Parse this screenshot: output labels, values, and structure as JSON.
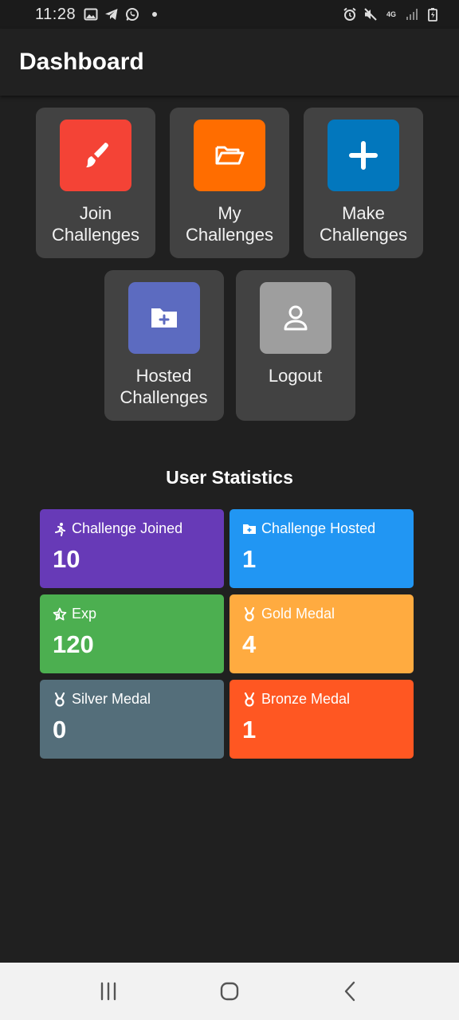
{
  "status_bar": {
    "time": "11:28",
    "left_icons": [
      "image-icon",
      "telegram-icon",
      "whatsapp-icon"
    ],
    "right_icons": [
      "alarm-icon",
      "mute-icon",
      "network-4g-icon",
      "signal-icon",
      "battery-charging-icon"
    ],
    "network_label": "4G"
  },
  "app_bar": {
    "title": "Dashboard"
  },
  "menu": [
    {
      "label": "Join Challenges",
      "icon": "brush-icon",
      "color": "#f44336"
    },
    {
      "label": "My Challenges",
      "icon": "folder-open-icon",
      "color": "#ff6d00"
    },
    {
      "label": "Make Challenges",
      "icon": "plus-icon",
      "color": "#0277bd"
    },
    {
      "label": "Hosted Challenges",
      "icon": "folder-add-icon",
      "color": "#5c6bc0"
    },
    {
      "label": "Logout",
      "icon": "user-icon",
      "color": "#9e9e9e"
    }
  ],
  "stats": {
    "title": "User Statistics",
    "items": [
      {
        "label": "Challenge Joined",
        "value": "10",
        "icon": "running-icon",
        "color": "#673ab7"
      },
      {
        "label": "Challenge Hosted",
        "value": "1",
        "icon": "folder-add-icon",
        "color": "#2196f3"
      },
      {
        "label": "Exp",
        "value": "120",
        "icon": "star-outline-icon",
        "color": "#4caf50"
      },
      {
        "label": "Gold Medal",
        "value": "4",
        "icon": "medal-icon",
        "color": "#ffab40"
      },
      {
        "label": "Silver Medal",
        "value": "0",
        "icon": "medal-icon",
        "color": "#546e7a"
      },
      {
        "label": "Bronze Medal",
        "value": "1",
        "icon": "medal-icon",
        "color": "#ff5722"
      }
    ]
  },
  "nav_bar": {
    "buttons": [
      "recent-apps-icon",
      "home-icon",
      "back-icon"
    ]
  }
}
